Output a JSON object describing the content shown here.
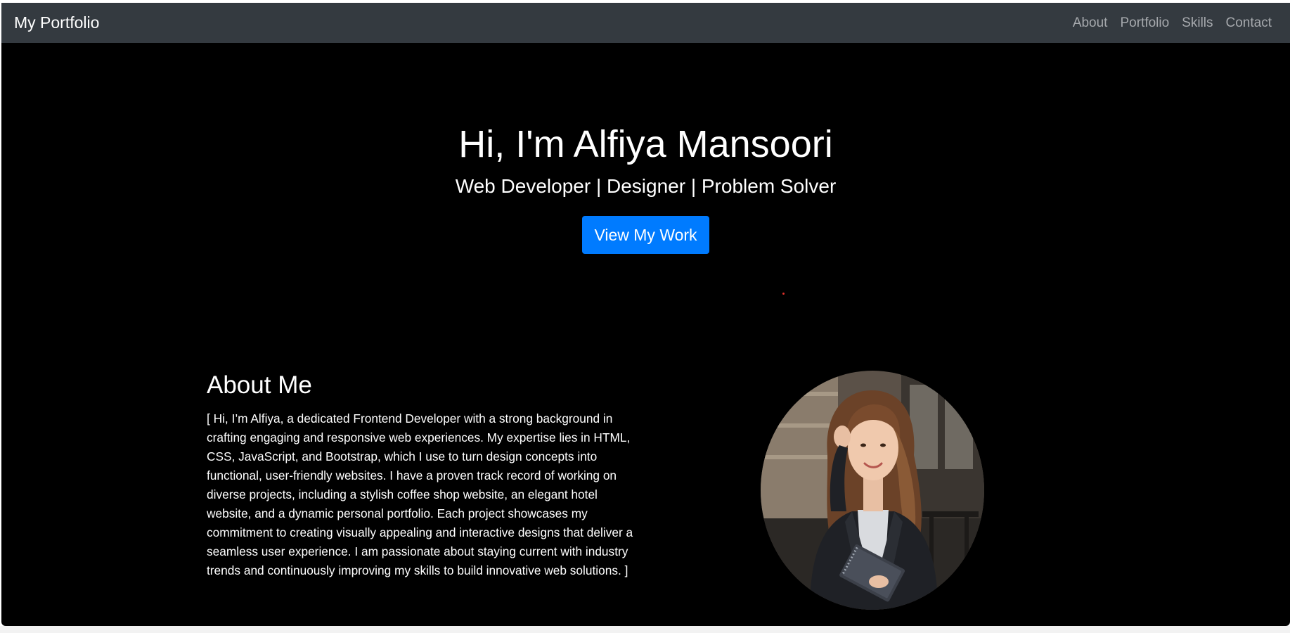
{
  "navbar": {
    "brand": "My Portfolio",
    "links": [
      "About",
      "Portfolio",
      "Skills",
      "Contact"
    ]
  },
  "hero": {
    "title": "Hi, I'm Alfiya Mansoori",
    "tagline": "Web Developer | Designer | Problem Solver",
    "cta_label": "View My Work"
  },
  "about": {
    "title": "About Me",
    "text": "[ Hi, I’m Alfiya, a dedicated Frontend Developer with a strong background in crafting engaging and responsive web experiences. My expertise lies in HTML, CSS, JavaScript, and Bootstrap, which I use to turn design concepts into functional, user-friendly websites. I have a proven track record of working on diverse projects, including a stylish coffee shop website, an elegant hotel website, and a dynamic personal portfolio. Each project showcases my commitment to creating visually appealing and interactive designs that deliver a seamless user experience. I am passionate about staying current with industry trends and continuously improving my skills to build innovative web solutions. ]"
  },
  "colors": {
    "navbar_bg": "#343a40",
    "page_bg": "#000000",
    "accent": "#007bff",
    "nav_link": "#a6a9ad"
  }
}
